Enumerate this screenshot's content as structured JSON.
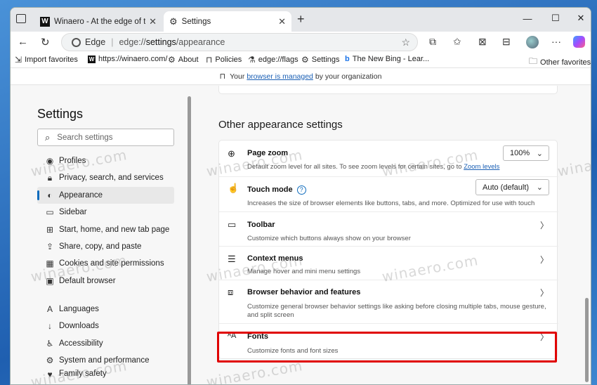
{
  "browser": {
    "tabs": [
      {
        "title": "Winaero - At the edge of tweaking",
        "icon": "winaero-icon"
      },
      {
        "title": "Settings",
        "icon": "gear-icon",
        "active": true
      }
    ],
    "address": {
      "label": "Edge",
      "url_prefix": "edge://",
      "url_bold": "settings",
      "url_suffix": "/appearance"
    },
    "favorites": [
      {
        "label": "Import favorites",
        "icon": "import-icon"
      },
      {
        "label": "https://winaero.com/",
        "icon": "winaero-icon"
      },
      {
        "label": "About",
        "icon": "gear-icon"
      },
      {
        "label": "Policies",
        "icon": "briefcase-icon"
      },
      {
        "label": "edge://flags",
        "icon": "flask-icon"
      },
      {
        "label": "Settings",
        "icon": "gear-icon"
      },
      {
        "label": "The New Bing - Lear...",
        "icon": "bing-icon"
      }
    ],
    "other_favorites": "Other favorites",
    "managed": {
      "prefix": "Your",
      "link": "browser is managed",
      "suffix": "by your organization"
    }
  },
  "sidebar": {
    "title": "Settings",
    "search_placeholder": "Search settings",
    "items": [
      {
        "label": "Profiles",
        "icon": "profile-icon"
      },
      {
        "label": "Privacy, search, and services",
        "icon": "lock-icon"
      },
      {
        "label": "Appearance",
        "icon": "palette-icon",
        "active": true
      },
      {
        "label": "Sidebar",
        "icon": "sidebar-icon"
      },
      {
        "label": "Start, home, and new tab page",
        "icon": "home-icon"
      },
      {
        "label": "Share, copy, and paste",
        "icon": "share-icon"
      },
      {
        "label": "Cookies and site permissions",
        "icon": "cookie-icon"
      },
      {
        "label": "Default browser",
        "icon": "browser-icon"
      },
      {
        "label": "Languages",
        "icon": "language-icon"
      },
      {
        "label": "Downloads",
        "icon": "download-icon"
      },
      {
        "label": "Accessibility",
        "icon": "accessibility-icon"
      },
      {
        "label": "System and performance",
        "icon": "system-icon"
      },
      {
        "label": "Family safety",
        "icon": "family-icon"
      }
    ]
  },
  "main": {
    "section_title": "Other appearance settings",
    "rows": [
      {
        "title": "Page zoom",
        "desc": "Default zoom level for all sites. To see zoom levels for certain sites, go to",
        "link": "Zoom levels",
        "control": "100%",
        "icon": "zoom-icon"
      },
      {
        "title": "Touch mode",
        "desc": "Increases the size of browser elements like buttons, tabs, and more. Optimized for use with touch",
        "control": "Auto (default)",
        "icon": "touch-icon"
      },
      {
        "title": "Toolbar",
        "desc": "Customize which buttons always show on your browser",
        "icon": "toolbar-icon"
      },
      {
        "title": "Context menus",
        "desc": "Manage hover and mini menu settings",
        "icon": "menu-icon"
      },
      {
        "title": "Browser behavior and features",
        "desc": "Customize general browser behavior settings like asking before closing multiple tabs, mouse gesture, and split screen",
        "icon": "behavior-icon"
      },
      {
        "title": "Fonts",
        "desc": "Customize fonts and font sizes",
        "icon": "fonts-icon"
      }
    ]
  },
  "watermark": "winaero.com",
  "colors": {
    "accent": "#0f6cbd",
    "highlight": "#e00000"
  }
}
